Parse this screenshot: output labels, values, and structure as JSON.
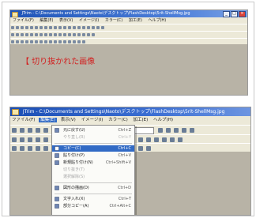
{
  "top_window": {
    "title": "JTrim - C:\\Documents and Settings\\Naoto\\デスクトップ\\FlashDesktop\\5rit-ShellMsg.jpg",
    "menu": [
      "ファイル(F)",
      "編集(E)",
      "表示(V)",
      "イメージ(I)",
      "カラー(C)",
      "加工(E)",
      "ヘルプ(H)"
    ],
    "canvas_text": "【 切り抜かれた画像"
  },
  "bottom_window": {
    "title": "JTrim - C:\\Documents and Settings\\Naoto\\デスクトップ\\FlashDesktop\\5rit-ShellMsg.jpg",
    "menu": [
      "ファイル(F)",
      "編集(E)",
      "表示(V)",
      "イメージ(I)",
      "カラー(C)",
      "加工(E)",
      "ヘルプ(H)"
    ],
    "active_menu_index": 1,
    "edit_menu": [
      {
        "label": "元に戻す(U)",
        "shortcut": "Ctrl+Z",
        "disabled": false,
        "selected": false,
        "icon": "undo-icon"
      },
      {
        "label": "やり直し(R)",
        "shortcut": "Ctrl+Y",
        "disabled": true,
        "selected": false,
        "icon": ""
      },
      {
        "sep": true
      },
      {
        "label": "コピー(C)",
        "shortcut": "Ctrl+C",
        "disabled": false,
        "selected": true,
        "icon": "copy-icon"
      },
      {
        "label": "貼り付け(P)",
        "shortcut": "Ctrl+V",
        "disabled": false,
        "selected": false,
        "icon": "paste-icon"
      },
      {
        "label": "新規貼り付け(N)",
        "shortcut": "Ctrl+Shift+V",
        "disabled": false,
        "selected": false,
        "icon": "paste-new-icon"
      },
      {
        "label": "切り抜き(T)",
        "shortcut": "",
        "disabled": true,
        "selected": false,
        "icon": ""
      },
      {
        "label": "選択解除(S)",
        "shortcut": "",
        "disabled": true,
        "selected": false,
        "icon": ""
      },
      {
        "sep": true
      },
      {
        "label": "図形の描画(D)",
        "shortcut": "Ctrl+D",
        "disabled": false,
        "selected": false,
        "icon": "draw-shape-icon"
      },
      {
        "sep": true
      },
      {
        "label": "文字入れ(X)",
        "shortcut": "Ctrl+T",
        "disabled": false,
        "selected": false,
        "icon": "text-icon"
      },
      {
        "label": "部分コピー(A)",
        "shortcut": "Ctrl+Alt+C",
        "disabled": false,
        "selected": false,
        "icon": "partial-copy-icon"
      }
    ]
  },
  "colors": {
    "title_bar": "#1e54b8",
    "menu_bg": "#ece9d8",
    "canvas_bg": "#b8b3a6",
    "highlight": "#316ac5",
    "red_annotation": "#d21f1f"
  }
}
